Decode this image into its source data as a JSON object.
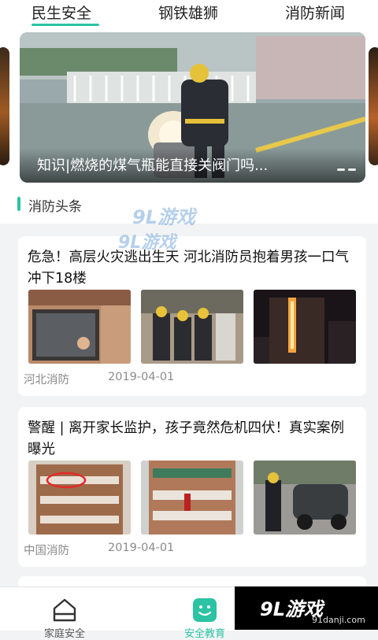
{
  "tabs": [
    "民生安全",
    "钢铁雄狮",
    "消防新闻"
  ],
  "active_tab": "民生安全",
  "accent_color": "#2bc3a3",
  "banner": {
    "caption": "知识|燃烧的煤气瓶能直接关阀门吗...",
    "image": "firefighter-gas-cylinder-photo"
  },
  "section": {
    "title": "消防头条"
  },
  "news": [
    {
      "title": "危急！高层火灾逃出生天 河北消防员抱着男孩一口气冲下18楼",
      "source": "河北消防",
      "date": "2019-04-01",
      "images": [
        "window-rescue-photo",
        "firefighters-carrying-child-photo",
        "burning-highrise-night-photo"
      ]
    },
    {
      "title": "警醒 | 离开家长监护，孩子竟然危机四伏！真实案例曝光",
      "source": "中国消防",
      "date": "2019-04-01",
      "images": [
        "balcony-child-circled-photo",
        "building-balcony-photo",
        "burning-car-firefighter-photo"
      ]
    }
  ],
  "bottom_nav": [
    {
      "label": "家庭安全",
      "icon": "home-icon"
    },
    {
      "label": "安全教育",
      "icon": "smile-icon"
    }
  ],
  "watermark": {
    "logo": "9L游戏",
    "url": "91danji.com"
  }
}
